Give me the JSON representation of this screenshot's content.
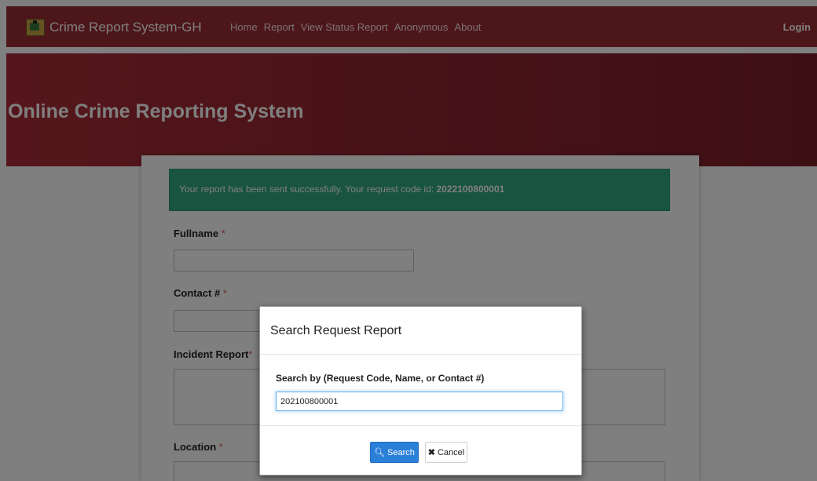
{
  "navbar": {
    "brand": "Crime Report System-GH",
    "links": [
      "Home",
      "Report",
      "View Status Report",
      "Anonymous",
      "About"
    ],
    "login": "Login"
  },
  "hero": {
    "title": "Online Crime Reporting System"
  },
  "alert": {
    "message": "Your report has been sent successfully. Your request code id: ",
    "code": "2022100800001"
  },
  "form": {
    "fullname_label": "Fullname",
    "contact_label": "Contact #",
    "incident_label": "Incident Report",
    "location_label": "Location",
    "required_marker": "*"
  },
  "modal": {
    "title": "Search Request Report",
    "search_label": "Search by (Request Code, Name, or Contact #)",
    "search_value": "202100800001",
    "search_button": "Search",
    "cancel_button": "Cancel"
  },
  "icons": {
    "search": "search-icon",
    "cancel": "close-icon",
    "logo": "coat-of-arms-icon"
  },
  "colors": {
    "navbar": "#9b2c35",
    "hero": "#a92d38",
    "alert": "#32a980",
    "primary_button": "#2a7fd8"
  }
}
